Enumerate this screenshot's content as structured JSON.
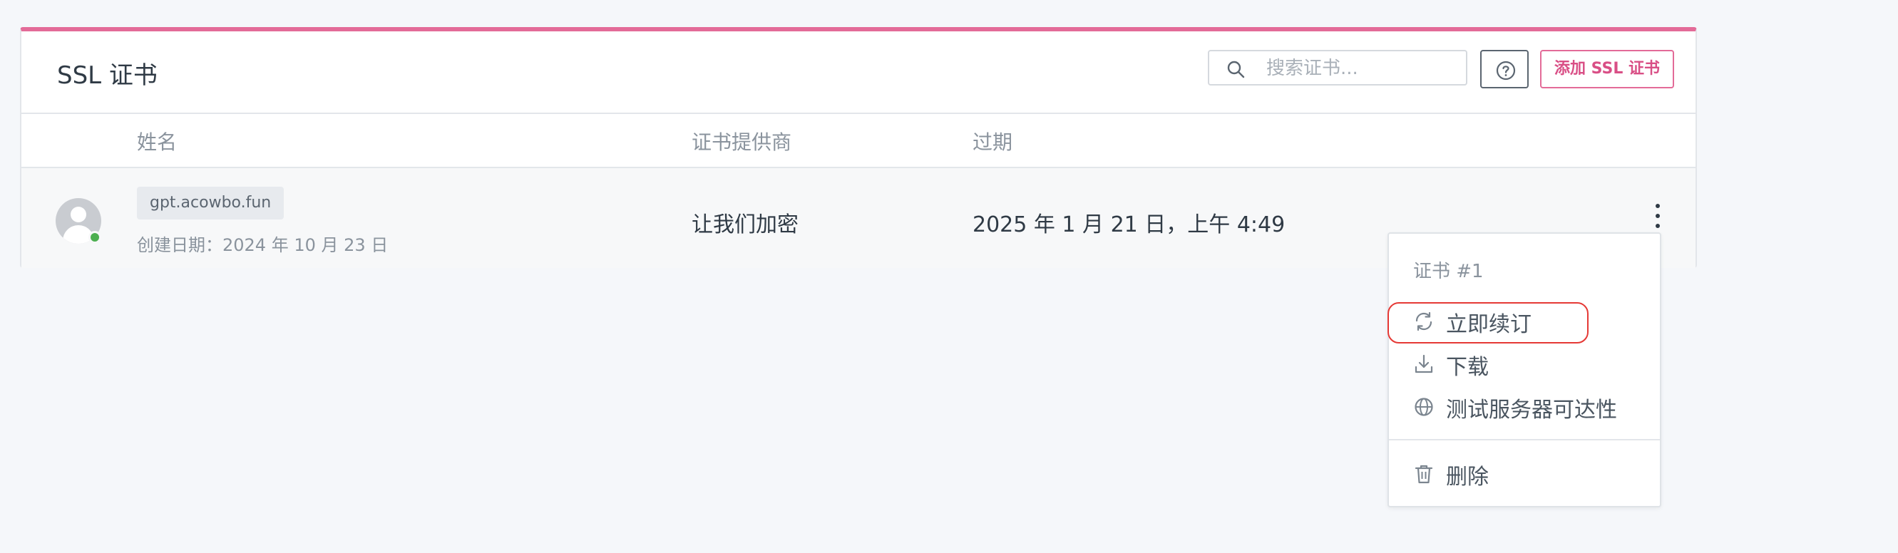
{
  "card": {
    "title": "SSL 证书"
  },
  "search": {
    "placeholder": "搜索证书..."
  },
  "actions": {
    "help_icon": "question-circle-icon",
    "add_label": "添加 SSL 证书"
  },
  "table": {
    "headers": {
      "name": "姓名",
      "provider": "证书提供商",
      "expiry": "过期"
    },
    "rows": [
      {
        "domain": "gpt.acowbo.fun",
        "created": "创建日期：2024 年 10 月 23 日",
        "provider": "让我们加密",
        "expiry": "2025 年 1 月 21 日，上午 4:49",
        "status_color": "#4caf50"
      }
    ]
  },
  "menu": {
    "header": "证书 #1",
    "items": [
      {
        "label": "立即续订",
        "icon": "refresh-icon"
      },
      {
        "label": "下载",
        "icon": "download-icon"
      },
      {
        "label": "测试服务器可达性",
        "icon": "globe-icon"
      },
      {
        "label": "删除",
        "icon": "trash-icon"
      }
    ]
  },
  "colors": {
    "accent": "#e36b98",
    "highlight": "#e53935"
  }
}
